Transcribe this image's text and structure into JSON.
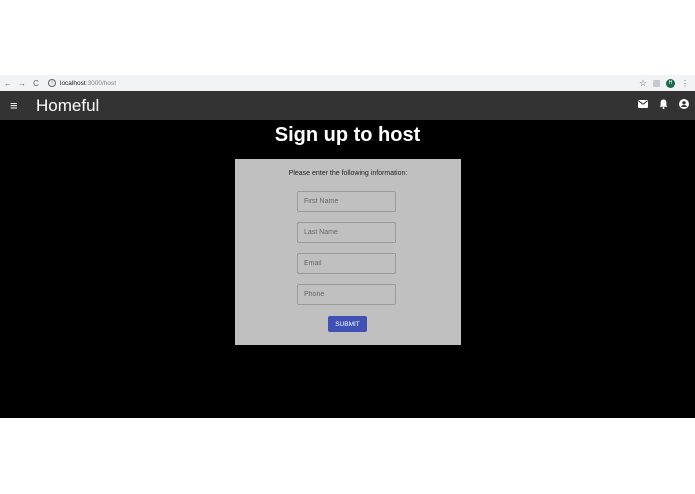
{
  "browser": {
    "back": "←",
    "forward": "→",
    "reload": "C",
    "url_host": "localhost",
    "url_path": ":3000/host",
    "avatar_initial": "H"
  },
  "app_bar": {
    "title": "Homeful"
  },
  "page": {
    "title": "Sign up to host"
  },
  "form": {
    "prompt": "Please enter the following information:",
    "first_name_placeholder": "First Name",
    "last_name_placeholder": "Last Name",
    "email_placeholder": "Email",
    "phone_placeholder": "Phone",
    "submit_label": "SUBMIT"
  }
}
